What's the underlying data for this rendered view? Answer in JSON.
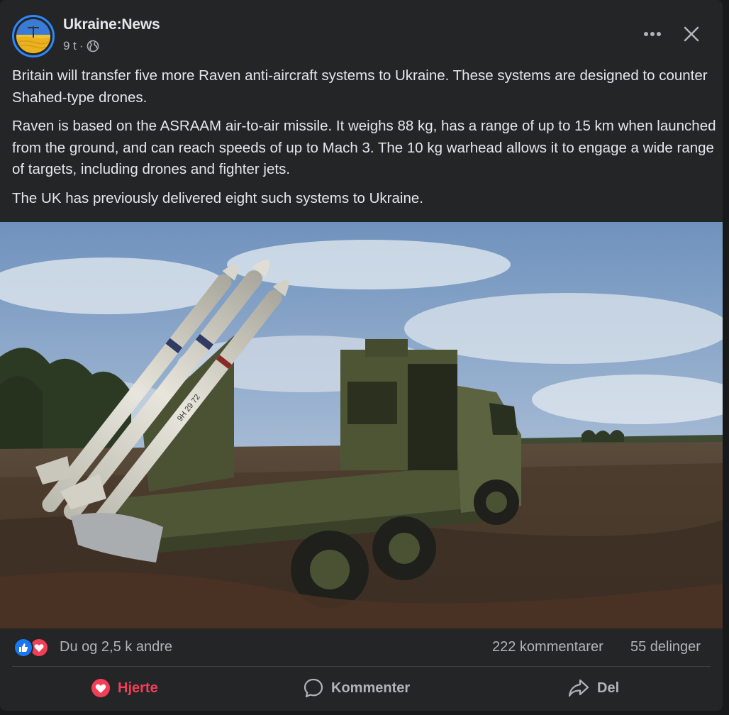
{
  "post": {
    "page_name": "Ukraine:News",
    "time": "9 t",
    "separator": "·",
    "privacy_icon": "globe-icon",
    "paragraphs": [
      "Britain will transfer five more Raven anti-aircraft systems to Ukraine. These systems are designed to counter Shahed-type drones.",
      "Raven is based on the ASRAAM air-to-air missile. It weighs 88 kg, has a range of up to 15 km when launched from the ground, and can reach speeds of up to Mach 3. The 10 kg warhead allows it to engage a wide range of targets, including drones and fighter jets.",
      "The UK has previously delivered eight such systems to Ukraine."
    ],
    "missile_markings": [
      "9H 29 72"
    ]
  },
  "header": {
    "more_icon": "more-options-icon",
    "close_icon": "close-icon"
  },
  "reactions": {
    "icons": [
      "like-icon",
      "love-icon"
    ],
    "summary": "Du og 2,5 k andre",
    "comments": "222 kommentarer",
    "shares": "55 delinger"
  },
  "actions": {
    "love_label": "Hjerte",
    "comment_label": "Kommenter",
    "share_label": "Del"
  },
  "colors": {
    "card_bg": "#242526",
    "page_bg": "#18191a",
    "text_primary": "#e4e6eb",
    "text_secondary": "#b0b3b8",
    "like_blue": "#1877f2",
    "love_red": "#f33e58",
    "avatar_ring": "#2d88ff"
  }
}
